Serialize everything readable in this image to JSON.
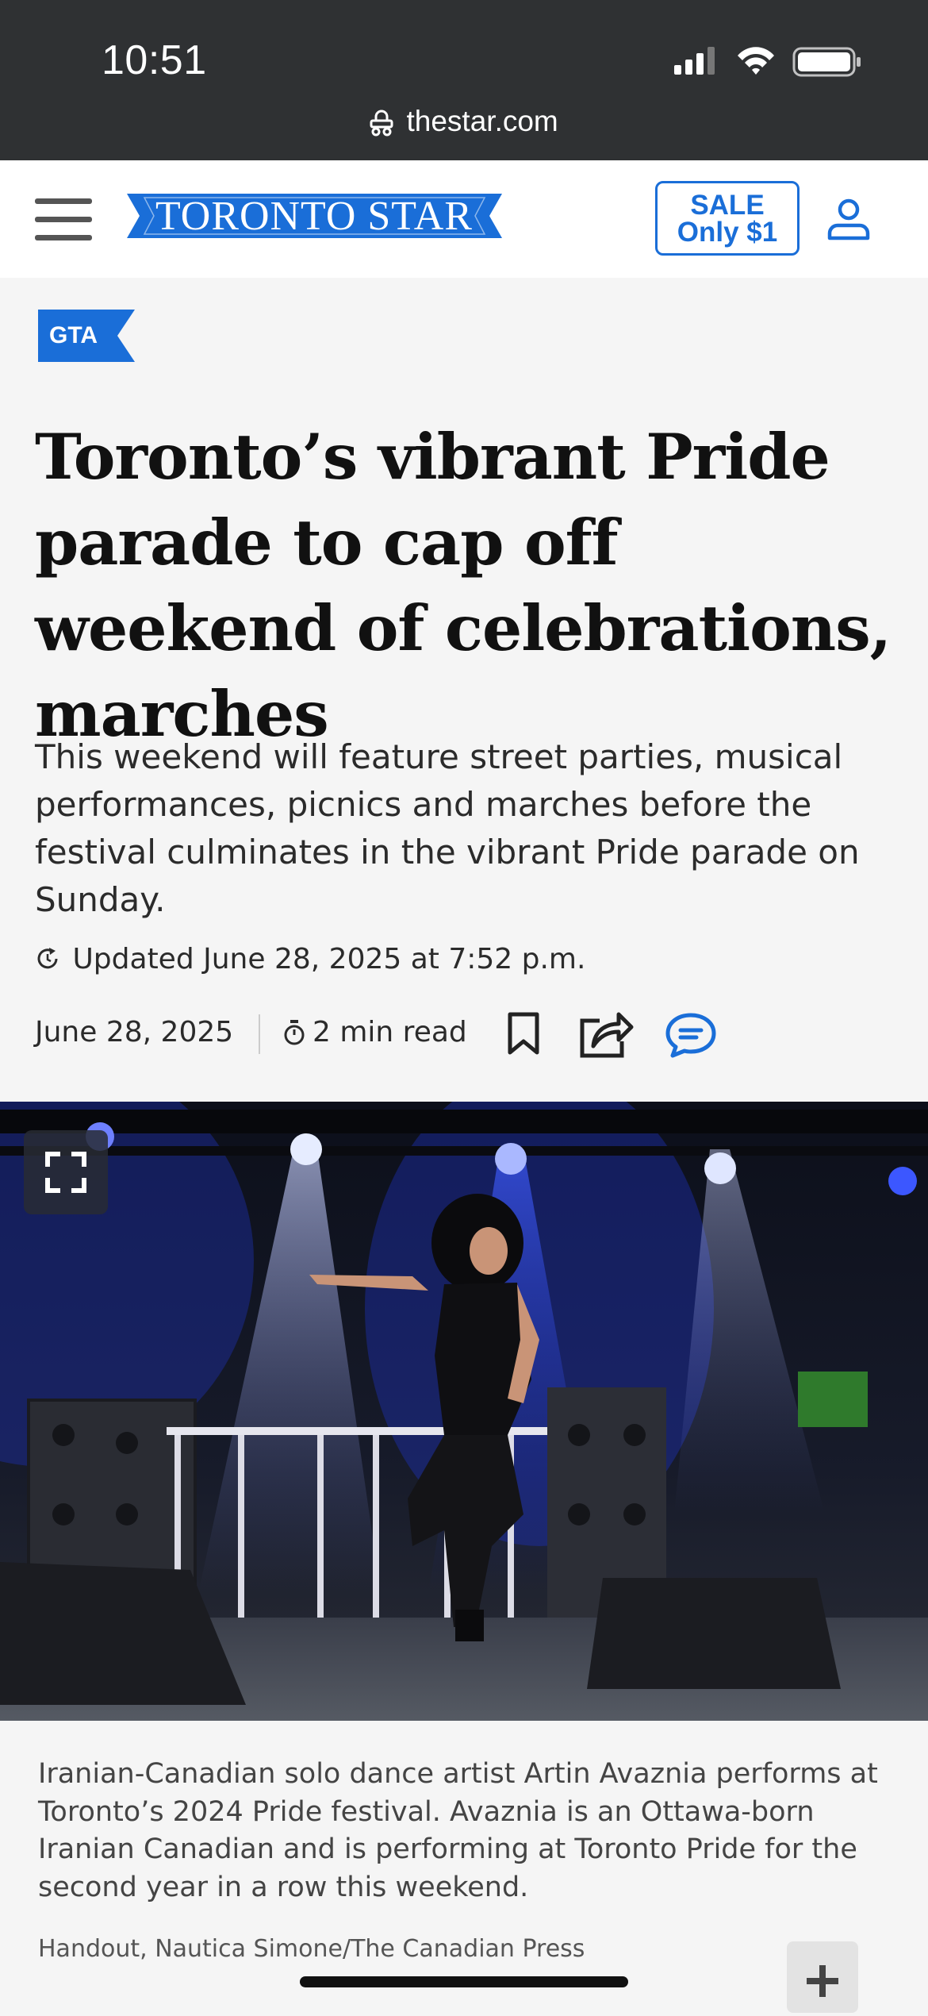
{
  "status_bar": {
    "time": "10:51",
    "icons": [
      "signal-icon",
      "wifi-icon",
      "battery-icon"
    ]
  },
  "browser": {
    "url": "thestar.com",
    "url_icon": "lock-icon"
  },
  "header": {
    "menu_icon": "hamburger-menu-icon",
    "logo_text": "TORONTO STAR",
    "sale_line1": "SALE",
    "sale_line2": "Only $1",
    "account_icon": "user-icon",
    "brand_color": "#1a6ed8"
  },
  "article": {
    "section_tag": "GTA",
    "headline": "Toronto’s vibrant Pride parade to cap off weekend of celebrations, marches",
    "deck": "This weekend will feature street parties, musical performances, picnics and marches before the festival culminates in the vibrant Pride parade on Sunday.",
    "updated": "Updated June 28, 2025 at 7:52 p.m.",
    "date": "June 28, 2025",
    "read_time": "2 min read",
    "actions": [
      "bookmark-icon",
      "share-icon",
      "comment-icon"
    ]
  },
  "photo": {
    "caption": "Iranian-Canadian solo dance artist Artin Avaznia performs at Toronto’s 2024 Pride festival. Avaznia is an Ottawa-born Iranian Canadian and is performing at Toronto Pride for the second year in a row this weekend.",
    "credit": "Handout, Nautica Simone/The Canadian Press",
    "expand_icon": "expand-icon",
    "more_icon": "plus-icon"
  }
}
